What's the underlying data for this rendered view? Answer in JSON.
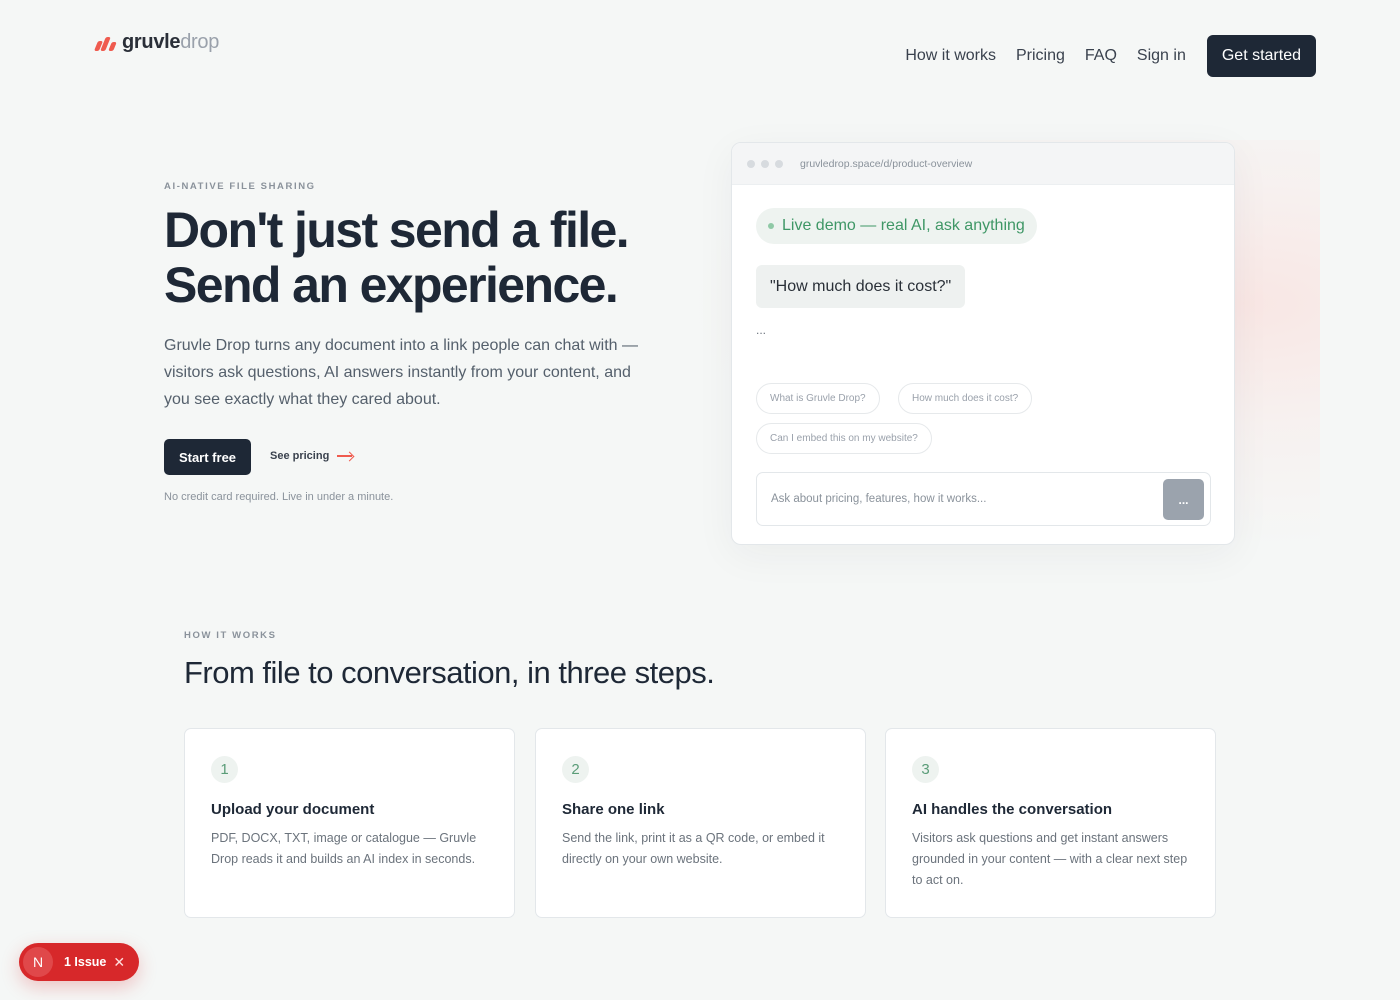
{
  "brand": {
    "name_part1": "gruvle",
    "name_part2": "drop",
    "accent": "#ef5b4f"
  },
  "nav": {
    "links": [
      "How it works",
      "Pricing",
      "FAQ",
      "Sign in"
    ],
    "cta": "Get started"
  },
  "hero": {
    "eyebrow": "AI-NATIVE FILE SHARING",
    "title_line1": "Don't just send a file.",
    "title_line2": "Send an experience.",
    "subtitle": "Gruvle Drop turns any document into a link people can chat with — visitors ask questions, AI answers instantly from your content, and you see exactly what they cared about.",
    "primary_cta": "Start free",
    "secondary_cta": "See pricing",
    "note": "No credit card required. Live in under a minute."
  },
  "demo": {
    "url": "gruvledrop.space/d/product-overview",
    "live_label": "Live demo — real AI, ask anything",
    "question": "\"How much does it cost?\"",
    "typing": "...",
    "suggestions": [
      "What is Gruvle Drop?",
      "How much does it cost?",
      "Can I embed this on my website?"
    ],
    "input_placeholder": "Ask about pricing, features, how it works...",
    "send_label": "..."
  },
  "how_it_works": {
    "eyebrow": "HOW IT WORKS",
    "title": "From file to conversation, in three steps.",
    "steps": [
      {
        "number": "1",
        "title": "Upload your document",
        "body": "PDF, DOCX, TXT, image or catalogue — Gruvle Drop reads it and builds an AI index in seconds."
      },
      {
        "number": "2",
        "title": "Share one link",
        "body": "Send the link, print it as a QR code, or embed it directly on your own website."
      },
      {
        "number": "3",
        "title": "AI handles the conversation",
        "body": "Visitors ask questions and get instant answers grounded in your content — with a clear next step to act on."
      }
    ]
  },
  "dev_overlay": {
    "letter": "N",
    "label": "1 Issue",
    "close": "✕"
  }
}
